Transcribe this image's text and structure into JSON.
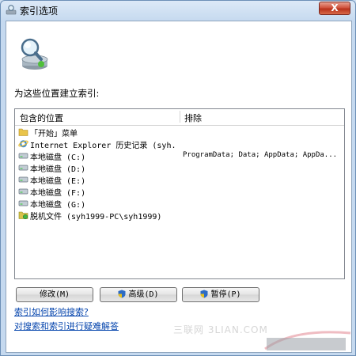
{
  "window": {
    "title": "索引选项",
    "close_label": "X"
  },
  "heading": "为这些位置建立索引:",
  "list": {
    "col_included": "包含的位置",
    "col_excluded": "排除",
    "rows": [
      {
        "name": "「开始」菜单",
        "exclude": "",
        "icon": "folder-icon"
      },
      {
        "name": "Internet Explorer 历史记录 (syh...",
        "exclude": "",
        "icon": "ie-icon"
      },
      {
        "name": "本地磁盘 (C:)",
        "exclude": "ProgramData; Data; AppData; AppDa...",
        "icon": "drive-icon"
      },
      {
        "name": "本地磁盘 (D:)",
        "exclude": "",
        "icon": "drive-icon"
      },
      {
        "name": "本地磁盘 (E:)",
        "exclude": "",
        "icon": "drive-icon"
      },
      {
        "name": "本地磁盘 (F:)",
        "exclude": "",
        "icon": "drive-icon"
      },
      {
        "name": "本地磁盘 (G:)",
        "exclude": "",
        "icon": "drive-icon"
      },
      {
        "name": "脱机文件 (syh1999-PC\\syh1999)",
        "exclude": "",
        "icon": "offline-files-icon"
      }
    ]
  },
  "watermark": "三联网 3LIAN.COM",
  "buttons": {
    "modify": "修改(M)",
    "advanced": "高级(D)",
    "pause": "暂停(P)"
  },
  "links": {
    "how_affects": "索引如何影响搜索?",
    "troubleshoot": "对搜索和索引进行疑难解答"
  },
  "colors": {
    "link": "#0645ad",
    "close": "#c8402a",
    "shield_blue": "#2d6bc4",
    "shield_yellow": "#e6c020"
  }
}
